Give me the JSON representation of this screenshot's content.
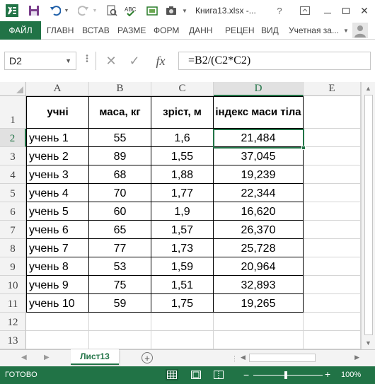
{
  "title": "Книга13.xlsx -...",
  "ribbon": {
    "file": "ФАЙЛ",
    "tabs": [
      "ГЛАВН",
      "ВСТАВ",
      "РАЗМЕ",
      "ФОРМ",
      "ДАНН",
      "РЕЦЕН",
      "ВИД"
    ],
    "account": "Учетная за..."
  },
  "formula_bar": {
    "name_box": "D2",
    "fx": "fx",
    "formula": "=B2/(C2*C2)"
  },
  "columns": [
    "A",
    "B",
    "C",
    "D",
    "E"
  ],
  "rows": [
    "1",
    "2",
    "3",
    "4",
    "5",
    "6",
    "7",
    "8",
    "9",
    "10",
    "11",
    "12",
    "13"
  ],
  "table": {
    "headers": [
      "учні",
      "маса, кг",
      "зріст, м",
      "індекс маси тіла"
    ],
    "rows": [
      [
        "учень 1",
        "55",
        "1,6",
        "21,484"
      ],
      [
        "учень 2",
        "89",
        "1,55",
        "37,045"
      ],
      [
        "учень 3",
        "68",
        "1,88",
        "19,239"
      ],
      [
        "учень 4",
        "70",
        "1,77",
        "22,344"
      ],
      [
        "учень 5",
        "60",
        "1,9",
        "16,620"
      ],
      [
        "учень 6",
        "65",
        "1,57",
        "26,370"
      ],
      [
        "учень 7",
        "77",
        "1,73",
        "25,728"
      ],
      [
        "учень 8",
        "53",
        "1,59",
        "20,964"
      ],
      [
        "учень 9",
        "75",
        "1,51",
        "32,893"
      ],
      [
        "учень 10",
        "59",
        "1,75",
        "19,265"
      ]
    ]
  },
  "sheet_tab": "Лист13",
  "status": {
    "ready": "ГОТОВО",
    "zoom": "100%"
  },
  "colors": {
    "accent": "#217346"
  }
}
